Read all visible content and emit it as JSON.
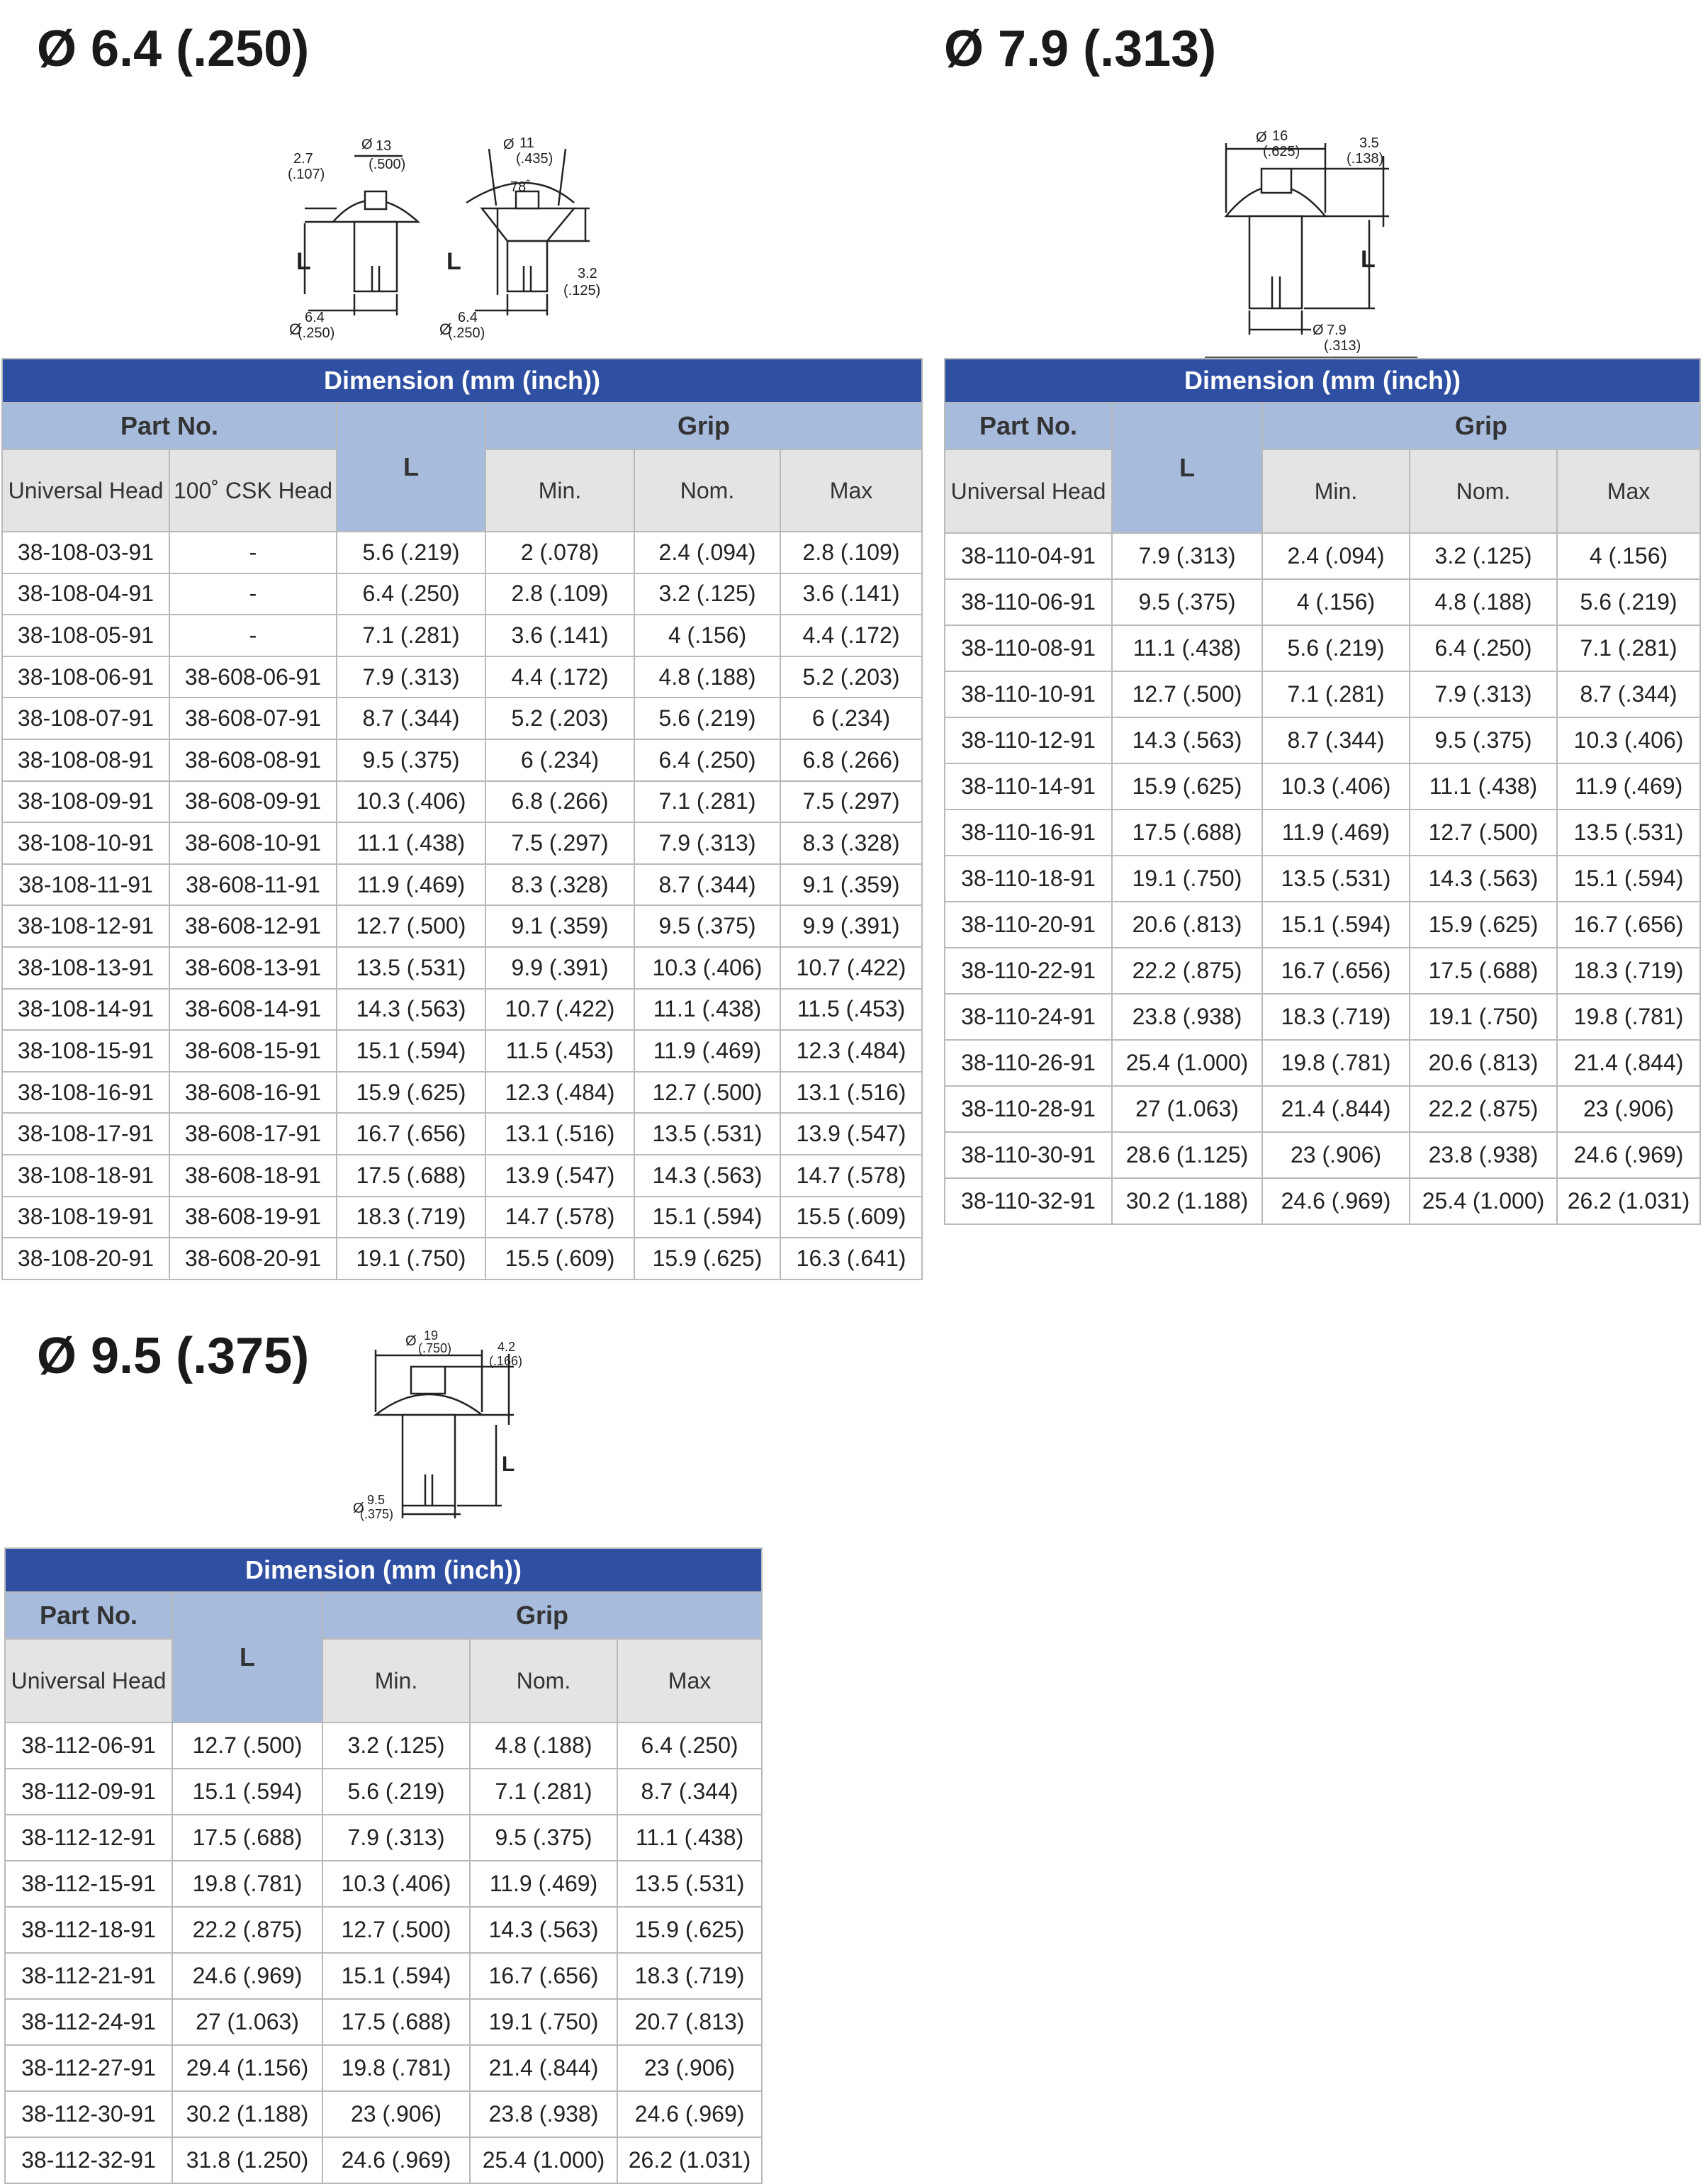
{
  "sections": [
    {
      "title": "Ø 6.4 (.250)",
      "diagram_labels": {
        "left_head_height": "2.7",
        "left_head_height_in": "(.107)",
        "left_head_dia": "13",
        "left_head_dia_in": "(.500)",
        "right_head_dia": "11",
        "right_head_dia_in": "(.435)",
        "angle": "78˚",
        "csk_height": "3.2",
        "csk_height_in": "(.125)",
        "body_dia_left": "6.4",
        "body_dia_left_in": "(.250)",
        "body_dia_right": "6.4",
        "body_dia_right_in": "(.250)",
        "length_symbol": "L",
        "dia_symbol": "Ø"
      },
      "table": {
        "caption": "Dimension (mm (inch))",
        "part_no_label": "Part No.",
        "l_label": "L",
        "grip_label": "Grip",
        "part_cols": [
          "Universal Head",
          "100˚ CSK Head"
        ],
        "grip_cols": [
          "Min.",
          "Nom.",
          "Max"
        ],
        "rows": [
          [
            "38-108-03-91",
            "-",
            "5.6 (.219)",
            "2 (.078)",
            "2.4 (.094)",
            "2.8 (.109)"
          ],
          [
            "38-108-04-91",
            "-",
            "6.4 (.250)",
            "2.8 (.109)",
            "3.2 (.125)",
            "3.6 (.141)"
          ],
          [
            "38-108-05-91",
            "-",
            "7.1 (.281)",
            "3.6 (.141)",
            "4 (.156)",
            "4.4 (.172)"
          ],
          [
            "38-108-06-91",
            "38-608-06-91",
            "7.9 (.313)",
            "4.4 (.172)",
            "4.8 (.188)",
            "5.2 (.203)"
          ],
          [
            "38-108-07-91",
            "38-608-07-91",
            "8.7 (.344)",
            "5.2 (.203)",
            "5.6 (.219)",
            "6 (.234)"
          ],
          [
            "38-108-08-91",
            "38-608-08-91",
            "9.5 (.375)",
            "6 (.234)",
            "6.4 (.250)",
            "6.8 (.266)"
          ],
          [
            "38-108-09-91",
            "38-608-09-91",
            "10.3 (.406)",
            "6.8 (.266)",
            "7.1 (.281)",
            "7.5 (.297)"
          ],
          [
            "38-108-10-91",
            "38-608-10-91",
            "11.1 (.438)",
            "7.5 (.297)",
            "7.9 (.313)",
            "8.3 (.328)"
          ],
          [
            "38-108-11-91",
            "38-608-11-91",
            "11.9 (.469)",
            "8.3 (.328)",
            "8.7 (.344)",
            "9.1 (.359)"
          ],
          [
            "38-108-12-91",
            "38-608-12-91",
            "12.7 (.500)",
            "9.1 (.359)",
            "9.5 (.375)",
            "9.9 (.391)"
          ],
          [
            "38-108-13-91",
            "38-608-13-91",
            "13.5 (.531)",
            "9.9 (.391)",
            "10.3 (.406)",
            "10.7 (.422)"
          ],
          [
            "38-108-14-91",
            "38-608-14-91",
            "14.3 (.563)",
            "10.7 (.422)",
            "11.1 (.438)",
            "11.5 (.453)"
          ],
          [
            "38-108-15-91",
            "38-608-15-91",
            "15.1 (.594)",
            "11.5 (.453)",
            "11.9 (.469)",
            "12.3 (.484)"
          ],
          [
            "38-108-16-91",
            "38-608-16-91",
            "15.9 (.625)",
            "12.3 (.484)",
            "12.7 (.500)",
            "13.1 (.516)"
          ],
          [
            "38-108-17-91",
            "38-608-17-91",
            "16.7 (.656)",
            "13.1 (.516)",
            "13.5 (.531)",
            "13.9 (.547)"
          ],
          [
            "38-108-18-91",
            "38-608-18-91",
            "17.5 (.688)",
            "13.9 (.547)",
            "14.3 (.563)",
            "14.7 (.578)"
          ],
          [
            "38-108-19-91",
            "38-608-19-91",
            "18.3 (.719)",
            "14.7 (.578)",
            "15.1 (.594)",
            "15.5 (.609)"
          ],
          [
            "38-108-20-91",
            "38-608-20-91",
            "19.1 (.750)",
            "15.5 (.609)",
            "15.9 (.625)",
            "16.3 (.641)"
          ]
        ]
      }
    },
    {
      "title": "Ø 7.9 (.313)",
      "diagram_labels": {
        "head_dia": "16",
        "head_dia_in": "(.625)",
        "head_height": "3.5",
        "head_height_in": "(.138)",
        "body_dia": "7.9",
        "body_dia_in": "(.313)",
        "length_symbol": "L",
        "dia_symbol": "Ø"
      },
      "table": {
        "caption": "Dimension (mm (inch))",
        "part_no_label": "Part No.",
        "l_label": "L",
        "grip_label": "Grip",
        "part_cols": [
          "Universal Head"
        ],
        "grip_cols": [
          "Min.",
          "Nom.",
          "Max"
        ],
        "rows": [
          [
            "38-110-04-91",
            "7.9 (.313)",
            "2.4 (.094)",
            "3.2 (.125)",
            "4 (.156)"
          ],
          [
            "38-110-06-91",
            "9.5 (.375)",
            "4 (.156)",
            "4.8 (.188)",
            "5.6 (.219)"
          ],
          [
            "38-110-08-91",
            "11.1 (.438)",
            "5.6 (.219)",
            "6.4 (.250)",
            "7.1 (.281)"
          ],
          [
            "38-110-10-91",
            "12.7 (.500)",
            "7.1 (.281)",
            "7.9 (.313)",
            "8.7 (.344)"
          ],
          [
            "38-110-12-91",
            "14.3 (.563)",
            "8.7 (.344)",
            "9.5 (.375)",
            "10.3 (.406)"
          ],
          [
            "38-110-14-91",
            "15.9 (.625)",
            "10.3 (.406)",
            "11.1 (.438)",
            "11.9 (.469)"
          ],
          [
            "38-110-16-91",
            "17.5 (.688)",
            "11.9 (.469)",
            "12.7 (.500)",
            "13.5 (.531)"
          ],
          [
            "38-110-18-91",
            "19.1 (.750)",
            "13.5 (.531)",
            "14.3 (.563)",
            "15.1 (.594)"
          ],
          [
            "38-110-20-91",
            "20.6 (.813)",
            "15.1 (.594)",
            "15.9 (.625)",
            "16.7 (.656)"
          ],
          [
            "38-110-22-91",
            "22.2 (.875)",
            "16.7 (.656)",
            "17.5 (.688)",
            "18.3 (.719)"
          ],
          [
            "38-110-24-91",
            "23.8 (.938)",
            "18.3 (.719)",
            "19.1 (.750)",
            "19.8 (.781)"
          ],
          [
            "38-110-26-91",
            "25.4 (1.000)",
            "19.8 (.781)",
            "20.6 (.813)",
            "21.4 (.844)"
          ],
          [
            "38-110-28-91",
            "27 (1.063)",
            "21.4 (.844)",
            "22.2 (.875)",
            "23 (.906)"
          ],
          [
            "38-110-30-91",
            "28.6 (1.125)",
            "23 (.906)",
            "23.8 (.938)",
            "24.6 (.969)"
          ],
          [
            "38-110-32-91",
            "30.2 (1.188)",
            "24.6 (.969)",
            "25.4 (1.000)",
            "26.2 (1.031)"
          ]
        ]
      }
    },
    {
      "title": "Ø 9.5 (.375)",
      "diagram_labels": {
        "head_dia": "19",
        "head_dia_in": "(.750)",
        "head_height": "4.2",
        "head_height_in": "(.166)",
        "body_dia": "9.5",
        "body_dia_in": "(.375)",
        "length_symbol": "L",
        "dia_symbol": "Ø"
      },
      "table": {
        "caption": "Dimension (mm (inch))",
        "part_no_label": "Part No.",
        "l_label": "L",
        "grip_label": "Grip",
        "part_cols": [
          "Universal Head"
        ],
        "grip_cols": [
          "Min.",
          "Nom.",
          "Max"
        ],
        "rows": [
          [
            "38-112-06-91",
            "12.7 (.500)",
            "3.2 (.125)",
            "4.8 (.188)",
            "6.4 (.250)"
          ],
          [
            "38-112-09-91",
            "15.1 (.594)",
            "5.6 (.219)",
            "7.1 (.281)",
            "8.7 (.344)"
          ],
          [
            "38-112-12-91",
            "17.5 (.688)",
            "7.9 (.313)",
            "9.5 (.375)",
            "11.1 (.438)"
          ],
          [
            "38-112-15-91",
            "19.8 (.781)",
            "10.3 (.406)",
            "11.9 (.469)",
            "13.5 (.531)"
          ],
          [
            "38-112-18-91",
            "22.2 (.875)",
            "12.7 (.500)",
            "14.3 (.563)",
            "15.9 (.625)"
          ],
          [
            "38-112-21-91",
            "24.6 (.969)",
            "15.1 (.594)",
            "16.7 (.656)",
            "18.3 (.719)"
          ],
          [
            "38-112-24-91",
            "27 (1.063)",
            "17.5 (.688)",
            "19.1 (.750)",
            "20.7 (.813)"
          ],
          [
            "38-112-27-91",
            "29.4 (1.156)",
            "19.8 (.781)",
            "21.4 (.844)",
            "23 (.906)"
          ],
          [
            "38-112-30-91",
            "30.2 (1.188)",
            "23 (.906)",
            "23.8 (.938)",
            "24.6 (.969)"
          ],
          [
            "38-112-32-91",
            "31.8 (1.250)",
            "24.6 (.969)",
            "25.4 (1.000)",
            "26.2 (1.031)"
          ]
        ]
      }
    }
  ]
}
